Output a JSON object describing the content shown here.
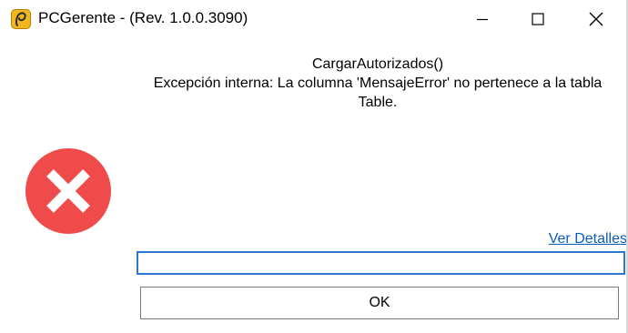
{
  "window": {
    "title": "PCGerente - (Rev. 1.0.0.3090)",
    "controls": {
      "minimize_icon": "minimize-icon",
      "maximize_icon": "maximize-icon",
      "close_icon": "close-icon"
    }
  },
  "dialog": {
    "icon": "error-icon",
    "icon_color": "#ef4b4b",
    "message_lines": [
      "CargarAutorizados()",
      "Excepción interna: La columna 'MensajeError' no pertenece a la tabla",
      "Table."
    ],
    "details_link": "Ver Detalles",
    "details_value": "",
    "ok_label": "OK"
  },
  "colors": {
    "link": "#0b5cc2",
    "focus_border": "#2a78d4",
    "app_icon": "#f0b81c"
  }
}
